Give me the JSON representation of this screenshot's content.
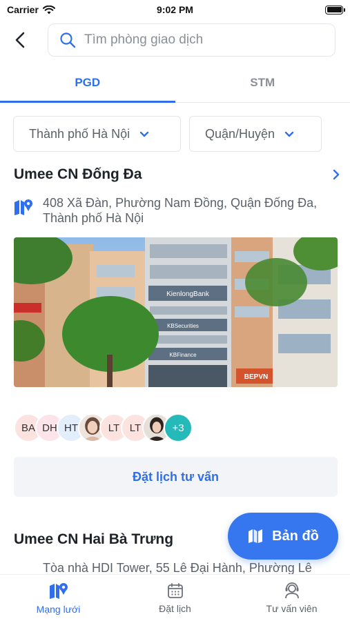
{
  "status_bar": {
    "carrier": "Carrier",
    "time": "9:02 PM"
  },
  "search": {
    "placeholder": "Tìm phòng giao dịch"
  },
  "tabs": [
    {
      "label": "PGD",
      "active": true
    },
    {
      "label": "STM",
      "active": false
    }
  ],
  "filters": {
    "city": "Thành phố Hà Nội",
    "district": "Quận/Huyện"
  },
  "branches": [
    {
      "name": "Umee CN Đống Đa",
      "address": "408 Xã Đàn, Phường Nam Đồng, Quận Đống Đa, Thành phố Hà Nội",
      "photo_signs": [
        "KienlongBank",
        "KBSecurities",
        "KBFinance",
        "BEPVN"
      ],
      "advisors": [
        {
          "initials": "BA",
          "color": "#fde3df",
          "photo": false
        },
        {
          "initials": "DH",
          "color": "#fde3ea",
          "photo": false
        },
        {
          "initials": "HT",
          "color": "#e2eefb",
          "photo": false
        },
        {
          "initials": "",
          "color": "#e9d6cf",
          "photo": true
        },
        {
          "initials": "LT",
          "color": "#fde3df",
          "photo": false
        },
        {
          "initials": "LT",
          "color": "#fde3df",
          "photo": false
        },
        {
          "initials": "",
          "color": "#d9cfc6",
          "photo": true
        }
      ],
      "more_count": "+3",
      "cta": "Đặt lịch tư vấn"
    },
    {
      "name": "Umee CN Hai Bà Trưng",
      "address": "Tòa nhà HDI Tower, 55 Lê Đại Hành, Phường Lê"
    }
  ],
  "map_button": {
    "label": "Bản đồ"
  },
  "bottom_nav": [
    {
      "label": "Mạng lưới",
      "icon": "map-network-icon",
      "active": true
    },
    {
      "label": "Đặt lịch",
      "icon": "calendar-icon",
      "active": false
    },
    {
      "label": "Tư vấn viên",
      "icon": "advisor-icon",
      "active": false
    }
  ],
  "colors": {
    "accent": "#2f6fed",
    "more_badge": "#25b9b9"
  }
}
